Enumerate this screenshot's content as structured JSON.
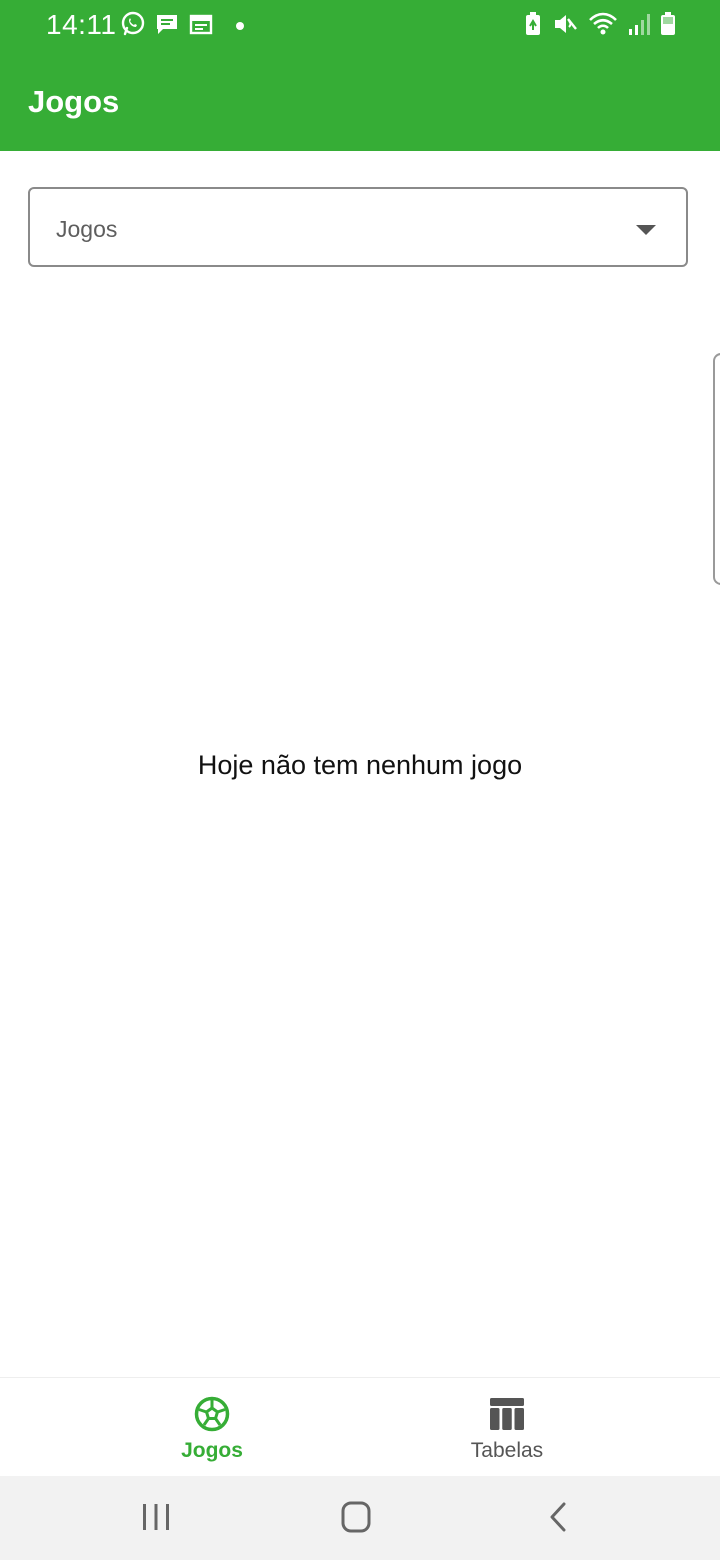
{
  "status_bar": {
    "time": "14:11",
    "left_icons": [
      "whatsapp-icon",
      "message-icon",
      "calendar-icon",
      "dot-icon"
    ],
    "right_icons": [
      "battery-saver-icon",
      "mute-icon",
      "wifi-icon",
      "signal-icon",
      "battery-icon"
    ]
  },
  "app_bar": {
    "title": "Jogos"
  },
  "filter": {
    "selected": "Jogos"
  },
  "empty_state": {
    "message": "Hoje não tem nenhum jogo"
  },
  "bottom_nav": {
    "items": [
      {
        "label": "Jogos",
        "icon": "soccer-ball-icon",
        "active": true
      },
      {
        "label": "Tabelas",
        "icon": "table-icon",
        "active": false
      }
    ]
  },
  "system_nav": {
    "buttons": [
      "recents-icon",
      "home-icon",
      "back-icon"
    ]
  },
  "colors": {
    "primary": "#36ad36",
    "inactive": "#555555",
    "system_nav_bg": "#f2f2f2"
  }
}
